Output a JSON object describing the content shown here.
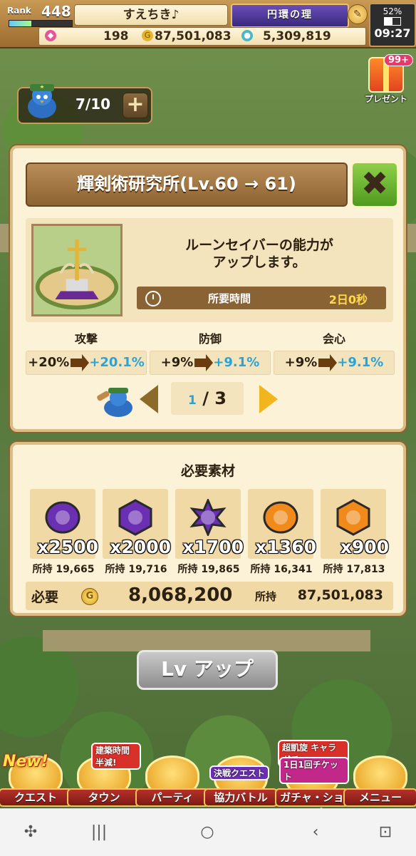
{
  "topbar": {
    "rank_label": "Rank",
    "rank_value": "448",
    "rank_progress": 0.35,
    "player_name": "すえちき♪",
    "event_banner": "円環の理",
    "gems": "198",
    "gold": "87,501,083",
    "elixir": "5,309,819",
    "battery": "52%",
    "battery_level": 0.52,
    "time": "09:27"
  },
  "builders": {
    "count": "7/10"
  },
  "present": {
    "badge": "99+",
    "label": "プレゼント"
  },
  "upgrade": {
    "title": "輝剣術研究所(Lv.60 → 61)",
    "close_icon": "close-x-icon",
    "description_line1": "ルーンセイバーの能力が",
    "description_line2": "アップします。",
    "time_label": "所要時間",
    "time_value": "2日0秒",
    "stats": [
      {
        "label": "攻撃",
        "from": "+20%",
        "to": "+20.1%"
      },
      {
        "label": "防御",
        "from": "+9%",
        "to": "+9.1%"
      },
      {
        "label": "会心",
        "from": "+9%",
        "to": "+9.1%"
      }
    ],
    "page_current": "1",
    "page_total": "/ 3"
  },
  "materials": {
    "title": "必要素材",
    "items": [
      {
        "qty": "x2500",
        "owned": "所持 19,665",
        "color": "#6b2fb3",
        "shape": "stone"
      },
      {
        "qty": "x2000",
        "owned": "所持 19,716",
        "color": "#6b2fb3",
        "shape": "hex"
      },
      {
        "qty": "x1700",
        "owned": "所持 19,865",
        "color": "#6b2fb3",
        "shape": "star"
      },
      {
        "qty": "x1360",
        "owned": "所持 16,341",
        "color": "#f08a1a",
        "shape": "stone"
      },
      {
        "qty": "x900",
        "owned": "所持 17,813",
        "color": "#f08a1a",
        "shape": "hex"
      }
    ],
    "cost_label": "必要",
    "cost_value": "8,068,200",
    "owned_label": "所持",
    "owned_value": "87,501,083"
  },
  "lvup_button": "Lv アップ",
  "gamenav": {
    "items": [
      {
        "label": "クエスト",
        "badge": "New!"
      },
      {
        "label": "タウン",
        "badge": "建築時間 半減!"
      },
      {
        "label": "パーティ",
        "badge": ""
      },
      {
        "label": "協力バトル",
        "badge": "決戦クエスト"
      },
      {
        "label": "ガチャ・ショップ",
        "badge": "1日1回チケット"
      },
      {
        "label": "メニュー",
        "badge": ""
      }
    ],
    "gacha_top_text": "超凱旋 キャラ ガチャ"
  }
}
